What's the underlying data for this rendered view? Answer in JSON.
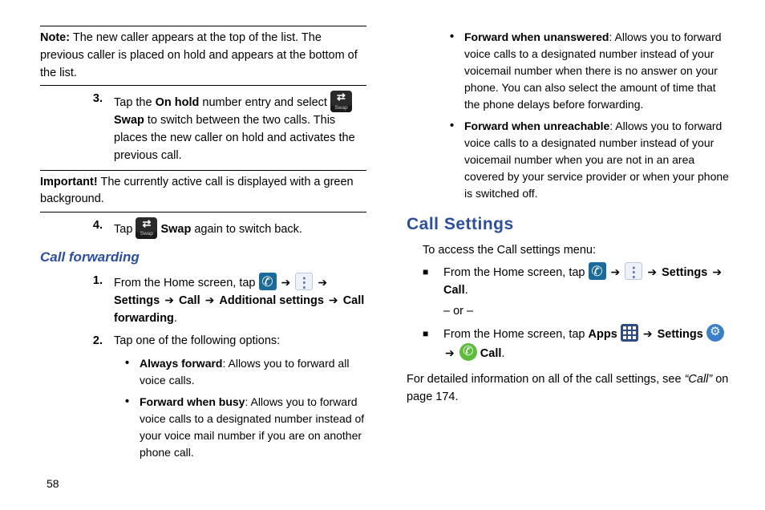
{
  "col1": {
    "note": {
      "label": "Note:",
      "text": "The new caller appears at the top of the list. The previous caller is placed on hold and appears at the bottom of the list."
    },
    "step3": {
      "num": "3.",
      "p1a": "Tap the ",
      "p1b": "On hold",
      "p1c": " number entry and select ",
      "p1d": "Swap",
      "p1e": " to switch between the two calls. This places the new caller on hold and activates the previous call."
    },
    "important": {
      "label": "Important!",
      "text": "The currently active call is displayed with a green background."
    },
    "step4": {
      "num": "4.",
      "p1a": "Tap ",
      "p1b": "Swap",
      "p1c": " again to switch back."
    },
    "cfHeading": "Call forwarding",
    "cf1": {
      "num": "1.",
      "a": "From the Home screen, tap ",
      "settings": "Settings",
      "call": "Call",
      "addl": "Additional settings",
      "cf": "Call forwarding",
      "dot": "."
    },
    "cf2": {
      "num": "2.",
      "text": "Tap one of the following options:"
    },
    "opts": {
      "af": {
        "label": "Always forward",
        "text": ": Allows you to forward all voice calls."
      },
      "fb": {
        "label": "Forward when busy",
        "text": ": Allows you to forward voice calls to a designated number instead of your voice mail number if you are on another phone call."
      }
    }
  },
  "col2": {
    "opts": {
      "fu": {
        "label": "Forward when unanswered",
        "text": ": Allows you to forward voice calls to a designated number instead of your voicemail number when there is no answer on your phone. You can also select the amount of time that the phone delays before forwarding."
      },
      "fr": {
        "label": "Forward when unreachable",
        "text": ": Allows you to forward voice calls to a designated number instead of your voicemail number when you are not in an area covered by your service provider or when your phone is switched off."
      }
    },
    "csHeading": "Call Settings",
    "csIntro": "To access the Call settings menu:",
    "path1": {
      "a": "From the Home screen, tap ",
      "settings": "Settings",
      "call": "Call",
      "dot": "."
    },
    "ordash": "– or –",
    "path2": {
      "a": "From the Home screen, tap ",
      "apps": "Apps",
      "settings": "Settings",
      "call": "Call",
      "dot": "."
    },
    "ref": {
      "a": "For detailed information on all of the call settings, see ",
      "b": "“Call”",
      "c": " on page 174."
    }
  },
  "page": "58"
}
